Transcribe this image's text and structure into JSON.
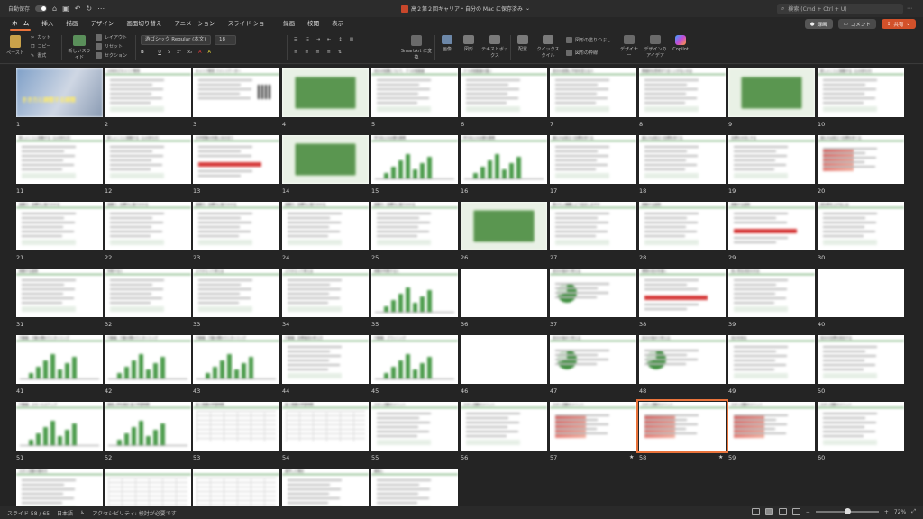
{
  "titlebar": {
    "autosave_label": "自動保存",
    "doc_title": "高２第２回キャリア・自分の Mac に保存済み",
    "search_placeholder": "検索 (Cmd + Ctrl + U)"
  },
  "menu": {
    "tabs": [
      "ホーム",
      "挿入",
      "描画",
      "デザイン",
      "画面切り替え",
      "アニメーション",
      "スライド ショー",
      "録画",
      "校閲",
      "表示"
    ],
    "active": "ホーム",
    "record_label": "録画",
    "comment_label": "コメント",
    "share_label": "共有"
  },
  "ribbon": {
    "paste": "ペースト",
    "cut": "カット",
    "copy": "コピー",
    "format": "書式",
    "new_slide": "新しいスライド",
    "layout": "レイアウト",
    "reset": "リセット",
    "section": "セクション",
    "font_name": "游ゴシック Regular (本文)",
    "font_size": "18",
    "smartart": "SmartArt に変換",
    "image": "画像",
    "shape": "図形",
    "textbox": "テキストボックス",
    "arrange": "配置",
    "quick_style": "クイックスタイル",
    "shape_fill": "図形の塗りつぶし",
    "shape_outline": "図形の枠線",
    "designer": "デザイナー",
    "designer_ideas": "デザインのアイデア",
    "copilot": "Copilot"
  },
  "sorter": {
    "slides": [
      {
        "n": "1",
        "kind": "title-photo",
        "caption": "きき力と調整する調整"
      },
      {
        "n": "2",
        "kind": "text",
        "title": "LENDEさキャリア教育"
      },
      {
        "n": "3",
        "kind": "text-qr",
        "title": "キャリア教育 ファシリテーター"
      },
      {
        "n": "4",
        "kind": "green"
      },
      {
        "n": "5",
        "kind": "text",
        "title": "自分の知識について、２つの知能論"
      },
      {
        "n": "6",
        "kind": "text",
        "title": "２つの知能論の違い"
      },
      {
        "n": "7",
        "kind": "text",
        "title": "自分の成長に不安を変える人"
      },
      {
        "n": "8",
        "kind": "text",
        "title": "積極的な思考がうまくいかないのは"
      },
      {
        "n": "9",
        "kind": "green"
      },
      {
        "n": "10",
        "kind": "text",
        "title": "新しいことに挑戦する（心の持ち方）"
      },
      {
        "n": "11",
        "kind": "text",
        "title": "新しいことに挑戦する（心の持ち方）"
      },
      {
        "n": "12",
        "kind": "text",
        "title": "新しいことに挑戦する（心の持ち方）"
      },
      {
        "n": "13",
        "kind": "text-red",
        "title": "大学受験の失敗に向き合う"
      },
      {
        "n": "14",
        "kind": "green"
      },
      {
        "n": "15",
        "kind": "chart",
        "title": "学力向上の必要な要素"
      },
      {
        "n": "16",
        "kind": "chart",
        "title": "学力向上の必要な要素"
      },
      {
        "n": "17",
        "kind": "text",
        "title": "進むかは役立つ目標を持てる"
      },
      {
        "n": "18",
        "kind": "text",
        "title": "進むかは役立つ目標を持てる"
      },
      {
        "n": "19",
        "kind": "text",
        "title": "目標を大切にする"
      },
      {
        "n": "20",
        "kind": "text-photo",
        "title": "進むかは役立つ目標を持てる"
      },
      {
        "n": "21",
        "kind": "text",
        "title": "重要力・目標力に取りかかる"
      },
      {
        "n": "22",
        "kind": "text",
        "title": "重要力・目標力に取りかかる"
      },
      {
        "n": "23",
        "kind": "text",
        "title": "重要力・目標力に取りかかる"
      },
      {
        "n": "24",
        "kind": "text",
        "title": "重要力・目標力に取りかかる"
      },
      {
        "n": "25",
        "kind": "text",
        "title": "重要力・目標力に取りかかる"
      },
      {
        "n": "26",
        "kind": "green"
      },
      {
        "n": "27",
        "kind": "text",
        "title": "受けたい講義にどう反応しますか"
      },
      {
        "n": "28",
        "kind": "text",
        "title": "挑戦する姿勢"
      },
      {
        "n": "29",
        "kind": "text-red",
        "title": "挑戦する姿勢"
      },
      {
        "n": "30",
        "kind": "text",
        "title": "成功率を上げるには"
      },
      {
        "n": "31",
        "kind": "text",
        "title": "挑戦する姿勢"
      },
      {
        "n": "32",
        "kind": "text",
        "title": "失敗すると"
      },
      {
        "n": "33",
        "kind": "text",
        "title": "ふりかえって考える"
      },
      {
        "n": "34",
        "kind": "text",
        "title": "ふりかえって考える"
      },
      {
        "n": "35",
        "kind": "chart",
        "title": "挑戦が失敗すると"
      },
      {
        "n": "36",
        "kind": "blank"
      },
      {
        "n": "37",
        "kind": "pie",
        "title": "自分の強みで考える"
      },
      {
        "n": "38",
        "kind": "text-red",
        "title": "理想の自分を描く"
      },
      {
        "n": "39",
        "kind": "text",
        "title": "良い意志決定の方法"
      },
      {
        "n": "40",
        "kind": "blank"
      },
      {
        "n": "41",
        "kind": "chart",
        "title": "行動編：行動の関わりとタイミング"
      },
      {
        "n": "42",
        "kind": "chart",
        "title": "行動編：行動の関わりとタイミング"
      },
      {
        "n": "43",
        "kind": "chart",
        "title": "行動編：行動の関わりとタイミング"
      },
      {
        "n": "44",
        "kind": "text",
        "title": "行動編：目標達成の考え方"
      },
      {
        "n": "45",
        "kind": "chart",
        "title": "行動編：プランニング"
      },
      {
        "n": "46",
        "kind": "blank"
      },
      {
        "n": "47",
        "kind": "pie",
        "title": "自分の強みで考える"
      },
      {
        "n": "48",
        "kind": "pie",
        "title": "自分の強みで考える"
      },
      {
        "n": "49",
        "kind": "text",
        "title": "自分を知る"
      },
      {
        "n": "50",
        "kind": "text",
        "title": "自分の目標を設定する"
      },
      {
        "n": "51",
        "kind": "chart",
        "title": "行動編：スモールステップ"
      },
      {
        "n": "52",
        "kind": "chart",
        "title": "継続入学を検討 高２学習時間"
      },
      {
        "n": "53",
        "kind": "table",
        "title": "高１実績の学習時間"
      },
      {
        "n": "54",
        "kind": "table",
        "title": "高１実績の学習時間"
      },
      {
        "n": "55",
        "kind": "text",
        "title": "スポン活動のメリット"
      },
      {
        "n": "56",
        "kind": "text",
        "title": "スポン活動のメリット"
      },
      {
        "n": "57",
        "kind": "text-photo",
        "title": "スポン活動のメリット",
        "star": true
      },
      {
        "n": "58",
        "kind": "text-photo",
        "title": "スポン活動のメリット",
        "star": true,
        "selected": true
      },
      {
        "n": "59",
        "kind": "text-photo",
        "title": "スポン活動のメリット"
      },
      {
        "n": "60",
        "kind": "text",
        "title": "スポン活動のメリット"
      },
      {
        "n": "61",
        "kind": "text",
        "title": "スポン活動の進め方"
      },
      {
        "n": "62",
        "kind": "table",
        "title": ""
      },
      {
        "n": "63",
        "kind": "table",
        "title": ""
      },
      {
        "n": "64",
        "kind": "text",
        "title": "進学した場合"
      },
      {
        "n": "65",
        "kind": "text",
        "title": "最後に"
      }
    ]
  },
  "status": {
    "slide_position": "スライド 58 / 65",
    "language": "日本語",
    "accessibility": "アクセシビリティ: 検討が必要です",
    "zoom": "72%"
  },
  "colors": {
    "accent": "#e9733b",
    "share": "#d2512a",
    "slide_green": "#4a9a4a"
  }
}
